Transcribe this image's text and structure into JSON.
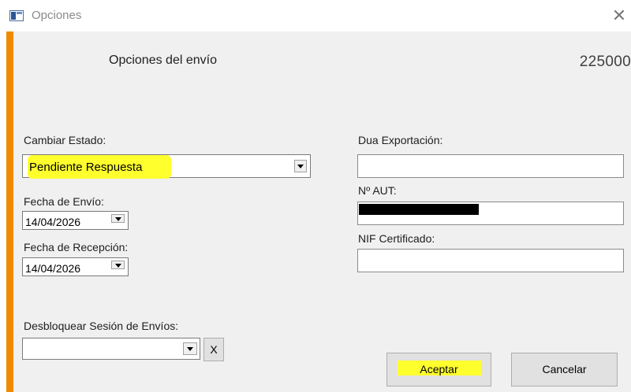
{
  "window": {
    "title": "Opciones",
    "close_glyph": "✕"
  },
  "header": {
    "heading": "Opciones del envío",
    "number": "225000"
  },
  "form": {
    "estado_label": "Cambiar Estado:",
    "estado_value": "Pendiente Respuesta",
    "fecha_envio_label": "Fecha de Envío:",
    "fecha_envio_value": "14/04/2026",
    "fecha_recepcion_label": "Fecha de Recepción:",
    "fecha_recepcion_value": "14/04/2026",
    "desbloquear_label": "Desbloquear Sesión de Envíos:",
    "desbloquear_value": "",
    "clear_button": "X",
    "dua_label": "Dua Exportación:",
    "dua_value": "",
    "aut_label": "Nº AUT:",
    "nif_label": "NIF Certificado:",
    "nif_value": ""
  },
  "buttons": {
    "accept": "Aceptar",
    "cancel": "Cancelar"
  },
  "colors": {
    "accent": "#f08a00",
    "highlight": "#ffff2e"
  },
  "icons": {
    "app": "window-app-icon",
    "close": "close-icon",
    "dropdown": "chevron-down-icon"
  }
}
